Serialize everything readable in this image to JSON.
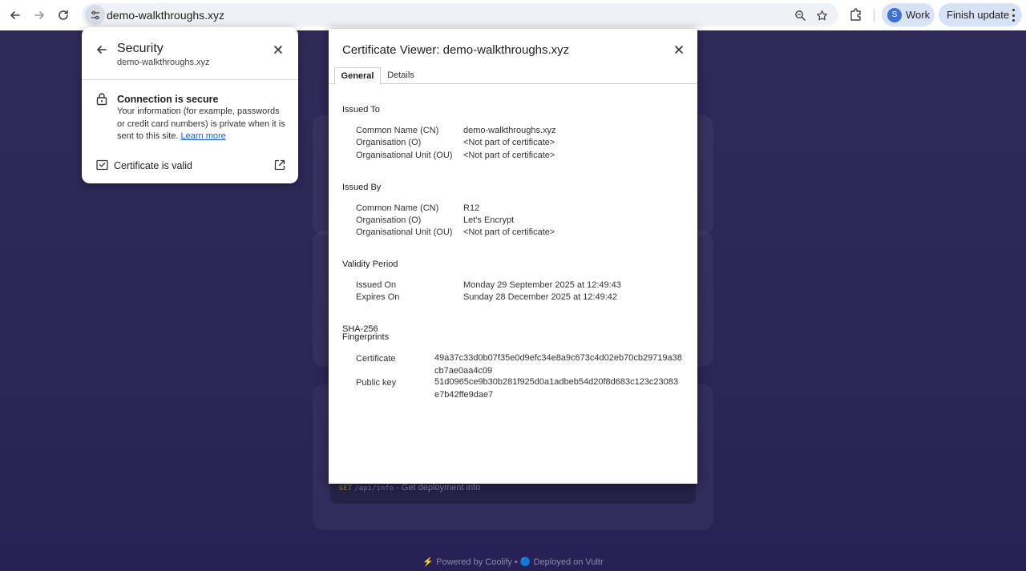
{
  "browser": {
    "url": "demo-walkthroughs.xyz",
    "profile": {
      "initial": "S",
      "name": "Work"
    },
    "update_label": "Finish update"
  },
  "background_page": {
    "api_method": "GET",
    "api_path": "/api/info",
    "api_desc": " - Get deployment info",
    "footer": "⚡ Powered by Coolify • 🔵 Deployed on Vultr"
  },
  "security_popup": {
    "title": "Security",
    "domain": "demo-walkthroughs.xyz",
    "connection_title": "Connection is secure",
    "connection_desc": "Your information (for example, passwords or credit card numbers) is private when it is sent to this site.",
    "learn_more": "Learn more",
    "certificate_label": "Certificate is valid"
  },
  "cert_viewer": {
    "title": "Certificate Viewer: demo-walkthroughs.xyz",
    "tabs": {
      "general": "General",
      "details": "Details"
    },
    "issued_to": {
      "heading": "Issued To",
      "fields": [
        {
          "label": "Common Name (CN)",
          "value": "demo-walkthroughs.xyz"
        },
        {
          "label": "Organisation (O)",
          "value": "<Not part of certificate>"
        },
        {
          "label": "Organisational Unit (OU)",
          "value": "<Not part of certificate>"
        }
      ]
    },
    "issued_by": {
      "heading": "Issued By",
      "fields": [
        {
          "label": "Common Name (CN)",
          "value": "R12"
        },
        {
          "label": "Organisation (O)",
          "value": "Let's Encrypt"
        },
        {
          "label": "Organisational Unit (OU)",
          "value": "<Not part of certificate>"
        }
      ]
    },
    "validity": {
      "heading": "Validity Period",
      "fields": [
        {
          "label": "Issued On",
          "value": "Monday 29 September 2025 at 12:49:43"
        },
        {
          "label": "Expires On",
          "value": "Sunday 28 December 2025 at 12:49:42"
        }
      ]
    },
    "fingerprints": {
      "heading_line1": "SHA-256",
      "heading_line2": "Fingerprints",
      "certificate_label": "Certificate",
      "certificate_line1": "49a37c33d0b07f35e0d9efc34e8a9c673c4d02eb70cb29719a38",
      "certificate_line2": "cb7ae0aa4c09",
      "public_key_label": "Public key",
      "public_key_line1": "51d0965ce9b30b281f925d0a1adbeb54d20f8d683c123c23083",
      "public_key_line2": "e7b42ffe9dae7"
    }
  },
  "colors": {
    "page_bg": "#2a2550",
    "accent_blue": "#1a57c9",
    "chip_bg": "#d8e2f5"
  }
}
